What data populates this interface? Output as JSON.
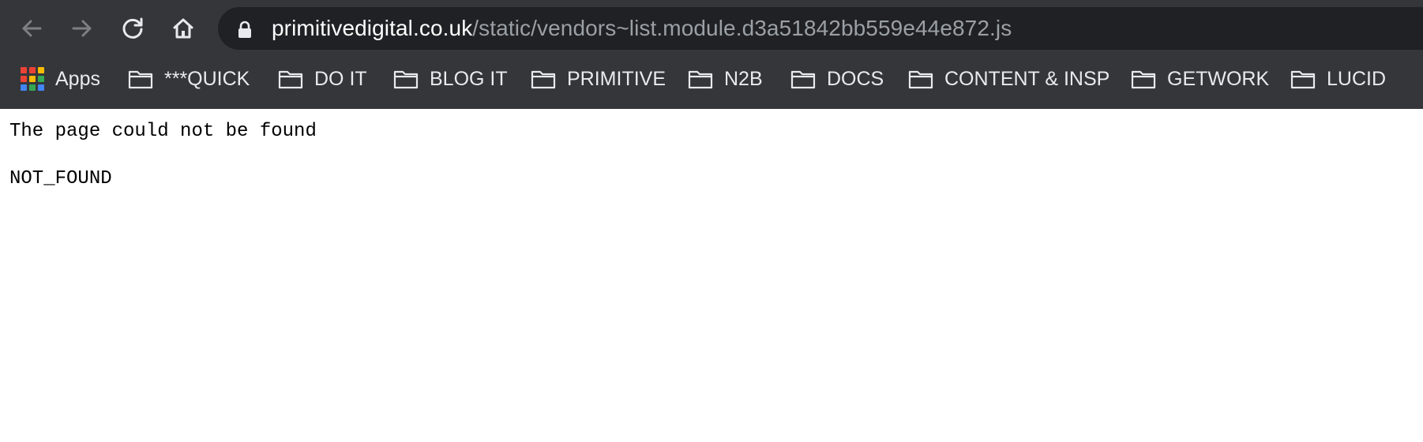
{
  "browser": {
    "nav": {
      "back_icon": "arrow-left-icon",
      "forward_icon": "arrow-right-icon",
      "reload_icon": "reload-icon",
      "home_icon": "home-icon"
    },
    "address_bar": {
      "lock_icon": "lock-icon",
      "host": "primitivedigital.co.uk",
      "path": "/static/vendors~list.module.d3a51842bb559e44e872.js"
    },
    "bookmarks": [
      {
        "label": "Apps",
        "icon": "apps-grid-icon"
      },
      {
        "label": "***QUICK",
        "icon": "folder-icon"
      },
      {
        "label": "DO IT",
        "icon": "folder-icon"
      },
      {
        "label": "BLOG IT",
        "icon": "folder-icon"
      },
      {
        "label": "PRIMITIVE",
        "icon": "folder-icon"
      },
      {
        "label": "N2B",
        "icon": "folder-icon"
      },
      {
        "label": "DOCS",
        "icon": "folder-icon"
      },
      {
        "label": "CONTENT & INSP",
        "icon": "folder-icon"
      },
      {
        "label": "GETWORK",
        "icon": "folder-icon"
      },
      {
        "label": "LUCID",
        "icon": "folder-icon"
      }
    ]
  },
  "page": {
    "message": "The page could not be found",
    "code": "NOT_FOUND"
  },
  "colors": {
    "chrome_bg": "#35363a",
    "omnibox_bg": "#202124",
    "url_host": "#ffffff",
    "url_path": "#9aa0a6",
    "apps_grid": [
      "#ea4335",
      "#fbbc04",
      "#34a853",
      "#4285f4"
    ]
  }
}
